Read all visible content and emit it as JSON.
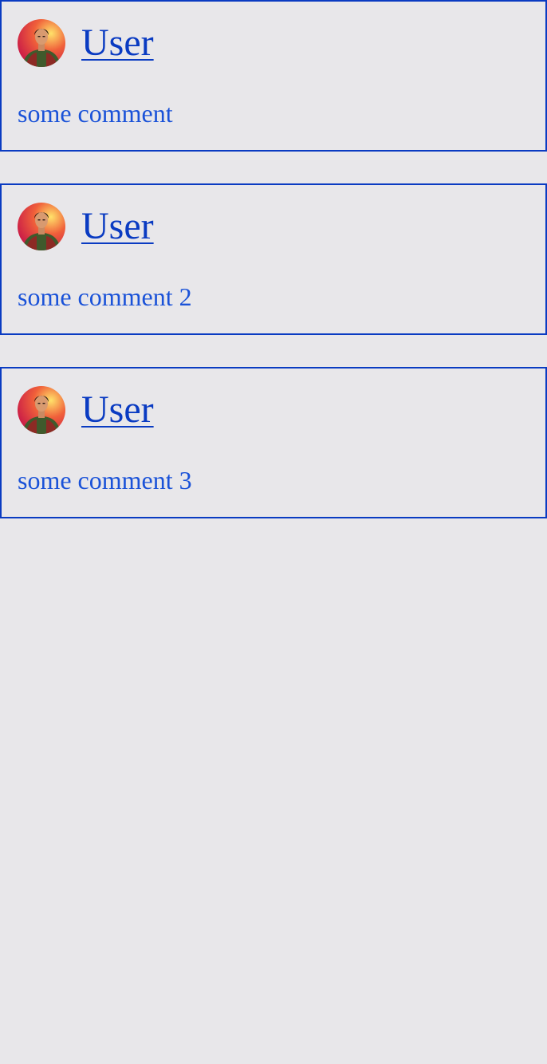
{
  "colors": {
    "background": "#e8e7ea",
    "border": "#0a3bc2",
    "link": "#0a3bc2",
    "comment_text": "#1a52d8"
  },
  "comments": [
    {
      "avatar_icon": "user-avatar-icon",
      "author": "User",
      "text": "some comment"
    },
    {
      "avatar_icon": "user-avatar-icon",
      "author": "User",
      "text": "some comment 2"
    },
    {
      "avatar_icon": "user-avatar-icon",
      "author": "User",
      "text": "some comment 3"
    }
  ]
}
